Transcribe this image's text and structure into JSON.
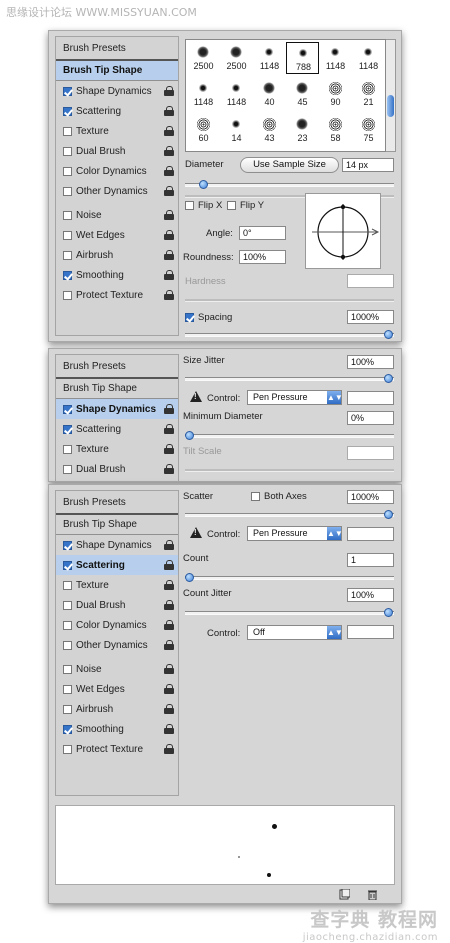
{
  "watermarks": {
    "top": "思缘设计论坛 WWW.MISSYUAN.COM",
    "bottom_main": "查字典 教程网",
    "bottom_url": "jiaocheng.chazidian.com"
  },
  "panel1": {
    "sidebar": {
      "presets": "Brush Presets",
      "tip_shape": "Brush Tip Shape",
      "items": [
        {
          "label": "Shape Dynamics",
          "checked": true
        },
        {
          "label": "Scattering",
          "checked": true
        },
        {
          "label": "Texture",
          "checked": false
        },
        {
          "label": "Dual Brush",
          "checked": false
        },
        {
          "label": "Color Dynamics",
          "checked": false
        },
        {
          "label": "Other Dynamics",
          "checked": false
        },
        {
          "label": "Noise",
          "checked": false
        },
        {
          "label": "Wet Edges",
          "checked": false
        },
        {
          "label": "Airbrush",
          "checked": false
        },
        {
          "label": "Smoothing",
          "checked": true
        },
        {
          "label": "Protect Texture",
          "checked": false
        }
      ]
    },
    "tips": [
      {
        "size": "2500",
        "icon": "splatter-brush-icon"
      },
      {
        "size": "2500",
        "icon": "splatter-brush-icon"
      },
      {
        "size": "1148",
        "icon": "star-brush-icon"
      },
      {
        "size": "788",
        "icon": "star-brush-icon"
      },
      {
        "size": "1148",
        "icon": "star-brush-icon"
      },
      {
        "size": "1148",
        "icon": "dot-brush-icon"
      },
      {
        "size": "1148",
        "icon": "star-brush-icon"
      },
      {
        "size": "1148",
        "icon": "star-brush-icon"
      },
      {
        "size": "40",
        "icon": "blob-brush-icon"
      },
      {
        "size": "45",
        "icon": "splatter-brush-icon"
      },
      {
        "size": "90",
        "icon": "texture-brush-icon"
      },
      {
        "size": "21",
        "icon": "texture-brush-icon"
      },
      {
        "size": "60",
        "icon": "texture-brush-icon"
      },
      {
        "size": "14",
        "icon": "star-brush-icon"
      },
      {
        "size": "43",
        "icon": "texture-brush-icon"
      },
      {
        "size": "23",
        "icon": "splatter-brush-icon"
      },
      {
        "size": "58",
        "icon": "texture-brush-icon"
      },
      {
        "size": "75",
        "icon": "texture-brush-icon"
      },
      {
        "size": "",
        "icon": "dot-brush-icon"
      },
      {
        "size": "",
        "icon": "blob-brush-icon"
      },
      {
        "size": "",
        "icon": "solid-brush-icon"
      },
      {
        "size": "",
        "icon": "solid-brush-icon"
      },
      {
        "size": "",
        "icon": "solid-brush-icon"
      },
      {
        "size": "",
        "icon": "leaf-brush-icon"
      }
    ],
    "diameter_label": "Diameter",
    "use_sample_size": "Use Sample Size",
    "diameter_value": "14 px",
    "diameter_level": 0.07,
    "flip_x": "Flip X",
    "flip_y": "Flip Y",
    "angle_label": "Angle:",
    "angle_value": "0°",
    "roundness_label": "Roundness:",
    "roundness_value": "100%",
    "hardness_label": "Hardness",
    "spacing_label": "Spacing",
    "spacing_value": "1000%",
    "spacing_level": 1.0
  },
  "panel2": {
    "sidebar": {
      "presets": "Brush Presets",
      "tip_shape": "Brush Tip Shape",
      "items": [
        {
          "label": "Shape Dynamics",
          "checked": true
        },
        {
          "label": "Scattering",
          "checked": true
        },
        {
          "label": "Texture",
          "checked": false
        },
        {
          "label": "Dual Brush",
          "checked": false
        }
      ]
    },
    "size_jitter_label": "Size Jitter",
    "size_jitter_value": "100%",
    "size_jitter_level": 1.0,
    "control_label": "Control:",
    "control_value": "Pen Pressure",
    "min_diameter_label": "Minimum Diameter",
    "min_diameter_value": "0%",
    "min_diameter_level": 0.0,
    "tilt_scale_label": "Tilt Scale"
  },
  "panel3": {
    "sidebar": {
      "presets": "Brush Presets",
      "tip_shape": "Brush Tip Shape",
      "items": [
        {
          "label": "Shape Dynamics",
          "checked": true
        },
        {
          "label": "Scattering",
          "checked": true
        },
        {
          "label": "Texture",
          "checked": false
        },
        {
          "label": "Dual Brush",
          "checked": false
        },
        {
          "label": "Color Dynamics",
          "checked": false
        },
        {
          "label": "Other Dynamics",
          "checked": false
        },
        {
          "label": "Noise",
          "checked": false
        },
        {
          "label": "Wet Edges",
          "checked": false
        },
        {
          "label": "Airbrush",
          "checked": false
        },
        {
          "label": "Smoothing",
          "checked": true
        },
        {
          "label": "Protect Texture",
          "checked": false
        }
      ]
    },
    "scatter_label": "Scatter",
    "both_axes": "Both Axes",
    "scatter_value": "1000%",
    "scatter_level": 1.0,
    "control1_label": "Control:",
    "control1_value": "Pen Pressure",
    "count_label": "Count",
    "count_value": "1",
    "count_level": 0.0,
    "count_jitter_label": "Count Jitter",
    "count_jitter_value": "100%",
    "count_jitter_level": 1.0,
    "control2_label": "Control:",
    "control2_value": "Off"
  }
}
